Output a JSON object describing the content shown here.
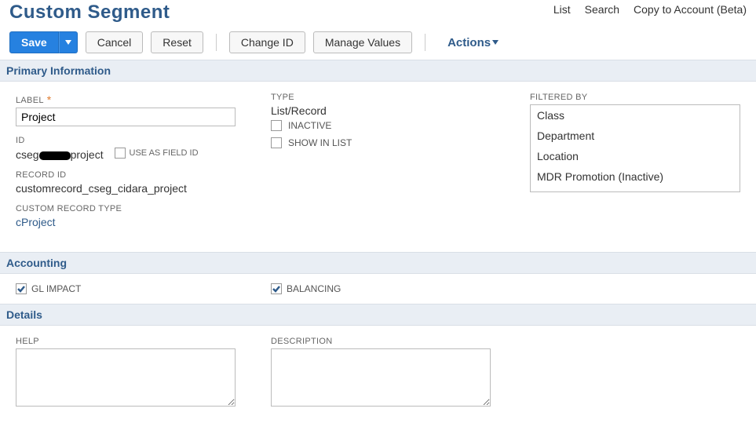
{
  "header": {
    "title": "Custom Segment",
    "links": {
      "list": "List",
      "search": "Search",
      "copy": "Copy to Account (Beta)"
    }
  },
  "toolbar": {
    "save": "Save",
    "cancel": "Cancel",
    "reset": "Reset",
    "change_id": "Change ID",
    "manage_values": "Manage Values",
    "actions": "Actions"
  },
  "sections": {
    "primary": "Primary Information",
    "accounting": "Accounting",
    "details": "Details"
  },
  "primary": {
    "label_label": "LABEL",
    "label_value": "Project",
    "id_label": "ID",
    "id_prefix": "cseg",
    "id_suffix": "project",
    "use_as_field_id": "USE AS FIELD ID",
    "record_id_label": "RECORD ID",
    "record_id_value": "customrecord_cseg_cidara_project",
    "custom_record_type_label": "CUSTOM RECORD TYPE",
    "custom_record_type_value": "cProject",
    "type_label": "TYPE",
    "type_value": "List/Record",
    "inactive": "INACTIVE",
    "show_in_list": "SHOW IN LIST",
    "filtered_by_label": "FILTERED BY",
    "filtered_by_items": [
      "Class",
      "Department",
      "Location",
      "MDR Promotion (Inactive)"
    ]
  },
  "accounting": {
    "gl_impact": "GL IMPACT",
    "balancing": "BALANCING"
  },
  "details": {
    "help_label": "HELP",
    "description_label": "DESCRIPTION"
  }
}
